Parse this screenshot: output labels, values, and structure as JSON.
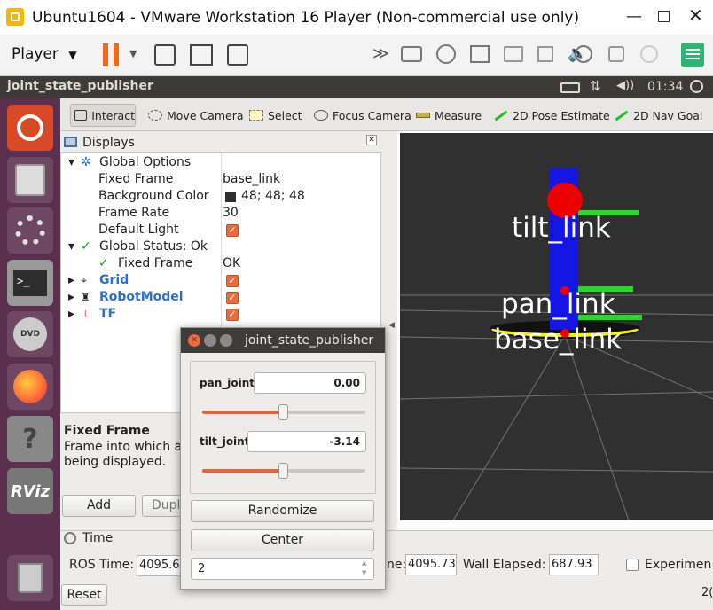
{
  "window": {
    "title": "Ubuntu1604 - VMware Workstation 16 Player (Non-commercial use only)"
  },
  "vmware_toolbar": {
    "player_label": "Player"
  },
  "ubuntu_bar": {
    "app_title": "joint_state_publisher",
    "clock": "01:34"
  },
  "rviz_toolbar": {
    "tools": [
      "Interact",
      "Move Camera",
      "Select",
      "Focus Camera",
      "Measure",
      "2D Pose Estimate",
      "2D Nav Goal"
    ]
  },
  "displays": {
    "title": "Displays",
    "global_options": "Global Options",
    "fixed_frame_label": "Fixed Frame",
    "fixed_frame_value": "base_link",
    "background_color_label": "Background Color",
    "background_color_value": "48; 48; 48",
    "frame_rate_label": "Frame Rate",
    "frame_rate_value": "30",
    "default_light_label": "Default Light",
    "global_status": "Global Status: Ok",
    "gs_fixed_frame_label": "Fixed Frame",
    "gs_fixed_frame_value": "OK",
    "grid": "Grid",
    "robot_model": "RobotModel",
    "tf": "TF",
    "desc_title": "Fixed Frame",
    "desc_line1": "Frame into which al",
    "desc_line2": "being displayed.",
    "add_button": "Add",
    "dup_button": "Dupl"
  },
  "scene_labels": {
    "tilt": "tilt_link",
    "pan": "pan_link",
    "base": "base_link"
  },
  "jsp_dialog": {
    "title": "joint_state_publisher",
    "pan_label": "pan_joint",
    "pan_value": "0.00",
    "pan_fraction": 0.5,
    "tilt_label": "tilt_joint",
    "tilt_value": "-3.14",
    "tilt_fraction": 0.5,
    "randomize": "Randomize",
    "center": "Center",
    "spin_value": "2"
  },
  "time_panel": {
    "title": "Time",
    "ros_time_label": "ROS Time:",
    "ros_time_value": "4095.69",
    "ros_elapsed_label_tail": "ne:",
    "ros_elapsed_value": "4095.73",
    "wall_elapsed_label": "Wall Elapsed:",
    "wall_elapsed_value": "687.93",
    "experimental_label": "Experimen",
    "reset_button": "Reset",
    "fps_tail": "2("
  },
  "colors": {
    "accent": "#e86c3e",
    "viewport_bg": "#303030",
    "launcher_bg": "#5b2f4e"
  }
}
